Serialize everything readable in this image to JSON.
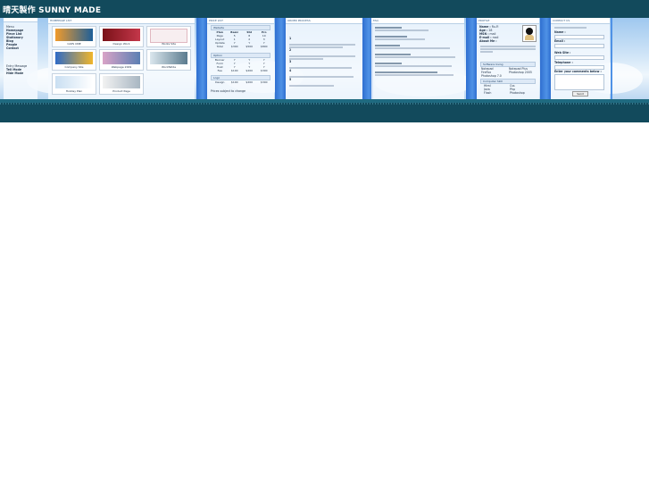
{
  "brand": {
    "title": "晴天製作 SUNNY MADE"
  },
  "colors": {
    "topbar": "#124a5c",
    "separator": "#3b7fe0",
    "sky": "#cfe4f7"
  },
  "menu": {
    "section_title": "Menu",
    "items": [
      "Homepage",
      "Piece List",
      "Stationary",
      "Blog",
      "People",
      "Contact"
    ],
    "section2_title": "Entry Message",
    "items2": [
      "Tell Mode",
      "Hide Mode"
    ]
  },
  "portfolio": {
    "title": "HOMEPAGE LIST",
    "items": [
      {
        "caption": "CAPS ONE",
        "icon": "blue-site-thumbnail"
      },
      {
        "caption": "Design Work",
        "icon": "red-site-thumbnail"
      },
      {
        "caption": "Works Site",
        "icon": "pink-site-thumbnail"
      },
      {
        "caption": "Company Site",
        "icon": "orange-site-thumbnail"
      },
      {
        "caption": "Webpage 2009",
        "icon": "photo-site-thumbnail"
      },
      {
        "caption": "WorldWide",
        "icon": "grey-site-thumbnail"
      },
      {
        "caption": "Holiday Plan",
        "icon": "flower-site-thumbnail"
      },
      {
        "caption": "Product Page",
        "icon": "snow-site-thumbnail"
      }
    ]
  },
  "price": {
    "title": "PRICE LIST",
    "sec1": "Website",
    "header": [
      "Plan",
      "Basic",
      "Std",
      "Pro"
    ],
    "rows1": [
      [
        "Page",
        "5",
        "8",
        "10"
      ],
      [
        "Layout",
        "1",
        "2",
        "3"
      ],
      [
        "Update",
        "Y",
        "Y",
        "Y"
      ],
      [
        "Total",
        "$300",
        "$500",
        "$800"
      ]
    ],
    "sec2": "Option",
    "rows2": [
      [
        "Banner",
        "Y",
        "Y",
        "Y"
      ],
      [
        "Form",
        "Y",
        "Y",
        "Y"
      ],
      [
        "Host",
        "Y",
        "Y",
        "Y"
      ],
      [
        "Fee",
        "$100",
        "$200",
        "$300"
      ]
    ],
    "sec3": "Logo",
    "rows3": [
      [
        "Design",
        "$100",
        "$200",
        "$300"
      ]
    ],
    "footnote": "Prices subject to change"
  },
  "notes": {
    "title": "ORDER PROCESS",
    "items": [
      "1",
      "2",
      "3",
      "4",
      "5"
    ]
  },
  "faq": {
    "title": "FAQ"
  },
  "profile": {
    "title": "PROFILE",
    "name_label": "Name :",
    "name_value": "Ru-Fi",
    "age_label": "Age :",
    "age_value": "28",
    "msn_label": "MSN :",
    "msn_value": "mail",
    "email_label": "E-mail :",
    "email_value": "mail",
    "about_label": "About Me :",
    "software_title": "Software Using",
    "software": [
      "Notepad",
      "Notepad Plus",
      "FireFox",
      "Photoshop 2005",
      "Photoshop 7.0"
    ],
    "computer_title": "Computer Skill",
    "skills": [
      "Html",
      "Css",
      "Java",
      "Php",
      "Flash",
      "Photoshop"
    ]
  },
  "contact": {
    "title": "CONTACT US",
    "name_label": "Name :",
    "email_label": "Email :",
    "website_label": "Web Site :",
    "phone_label": "Telephone :",
    "comments_label": "Enter your comments below :",
    "send_label": "Send"
  }
}
